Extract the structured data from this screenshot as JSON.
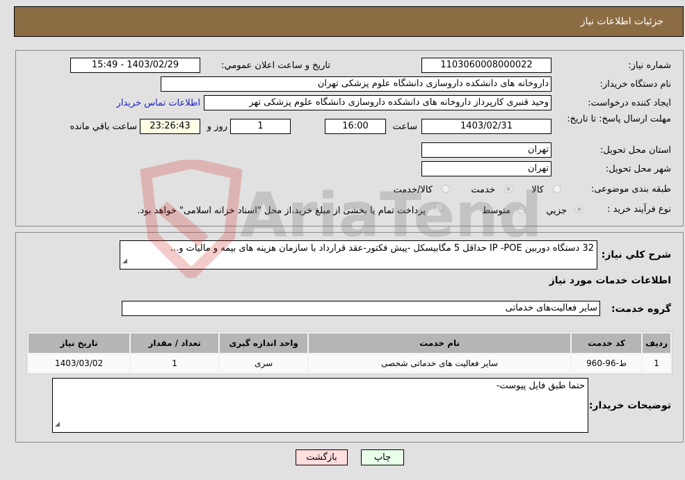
{
  "header": {
    "title": "جزئیات اطلاعات نیاز"
  },
  "form": {
    "need_number": {
      "label": "شماره نیاز:",
      "value": "1103060008000022"
    },
    "announce_datetime": {
      "label": "تاریخ و ساعت اعلان عمومي:",
      "value": "1403/02/29 - 15:49"
    },
    "buyer_org": {
      "label": "نام دستگاه خریدار:",
      "value": "داروخانه های دانشکده داروسازی دانشگاه علوم پزشکی تهران"
    },
    "requester": {
      "label": "ایجاد کننده درخواست:",
      "value": "وحید قنبری کارپرداز داروخانه های دانشکده داروسازی دانشگاه علوم پزشکی تهر",
      "contact_link": "اطلاعات تماس خریدار"
    },
    "deadline": {
      "label": "مهلت ارسال پاسخ: تا تاریخ:",
      "date": "1403/02/31",
      "time_label": "ساعت",
      "time": "16:00",
      "days": "1",
      "days_label": "روز و",
      "remaining": "23:26:43",
      "remaining_label": "ساعت باقي مانده"
    },
    "province": {
      "label": "استان محل تحویل:",
      "value": "تهران"
    },
    "city": {
      "label": "شهر محل تحویل:",
      "value": "تهران"
    },
    "category": {
      "label": "طبقه بندی موضوعی:",
      "options": [
        "کالا",
        "خدمت",
        "کالا/خدمت"
      ],
      "selected": "خدمت"
    },
    "purchase_type": {
      "label": "نوع فرآیند خرید :",
      "options": [
        "جزيي",
        "متوسط"
      ],
      "selected": "جزيي",
      "treasury_note": "پرداخت تمام یا بخشی از مبلغ خرید،از محل \"اسناد خزانه اسلامی\" خواهد بود."
    }
  },
  "description": {
    "label": "شرح کلي نیاز:",
    "value": "32 دستگاه دوربین IP -POE حداقل 5 مگابیسکل -پیش فکتور-عقد قرارداد با سازمان هزینه های بیمه و مالیات و..."
  },
  "services": {
    "section_title": "اطلاعات خدمات مورد نیاز",
    "group_label": "گروه خدمت:",
    "group_value": "سایر فعالیت‌های خدماتی",
    "table": {
      "columns": [
        "ردیف",
        "کد خدمت",
        "نام خدمت",
        "واحد اندازه گیری",
        "تعداد / مقدار",
        "تاریخ نیاز"
      ],
      "rows": [
        [
          "1",
          "ط-96-960",
          "سایر فعالیت های خدماتی شخصی",
          "سری",
          "1",
          "1403/03/02"
        ]
      ]
    }
  },
  "buyer_notes": {
    "label": "توضیحات خریدار:",
    "value": "حتما طبق فایل پیوست-"
  },
  "buttons": {
    "print": "چاپ",
    "back": "بازگشت"
  },
  "watermark": {
    "text": "AriaTender.neT"
  },
  "colors": {
    "header_bg": "#8b6c43",
    "print_bg": "#eaffea",
    "back_bg": "#ffdede",
    "link": "#1a1ac8"
  }
}
